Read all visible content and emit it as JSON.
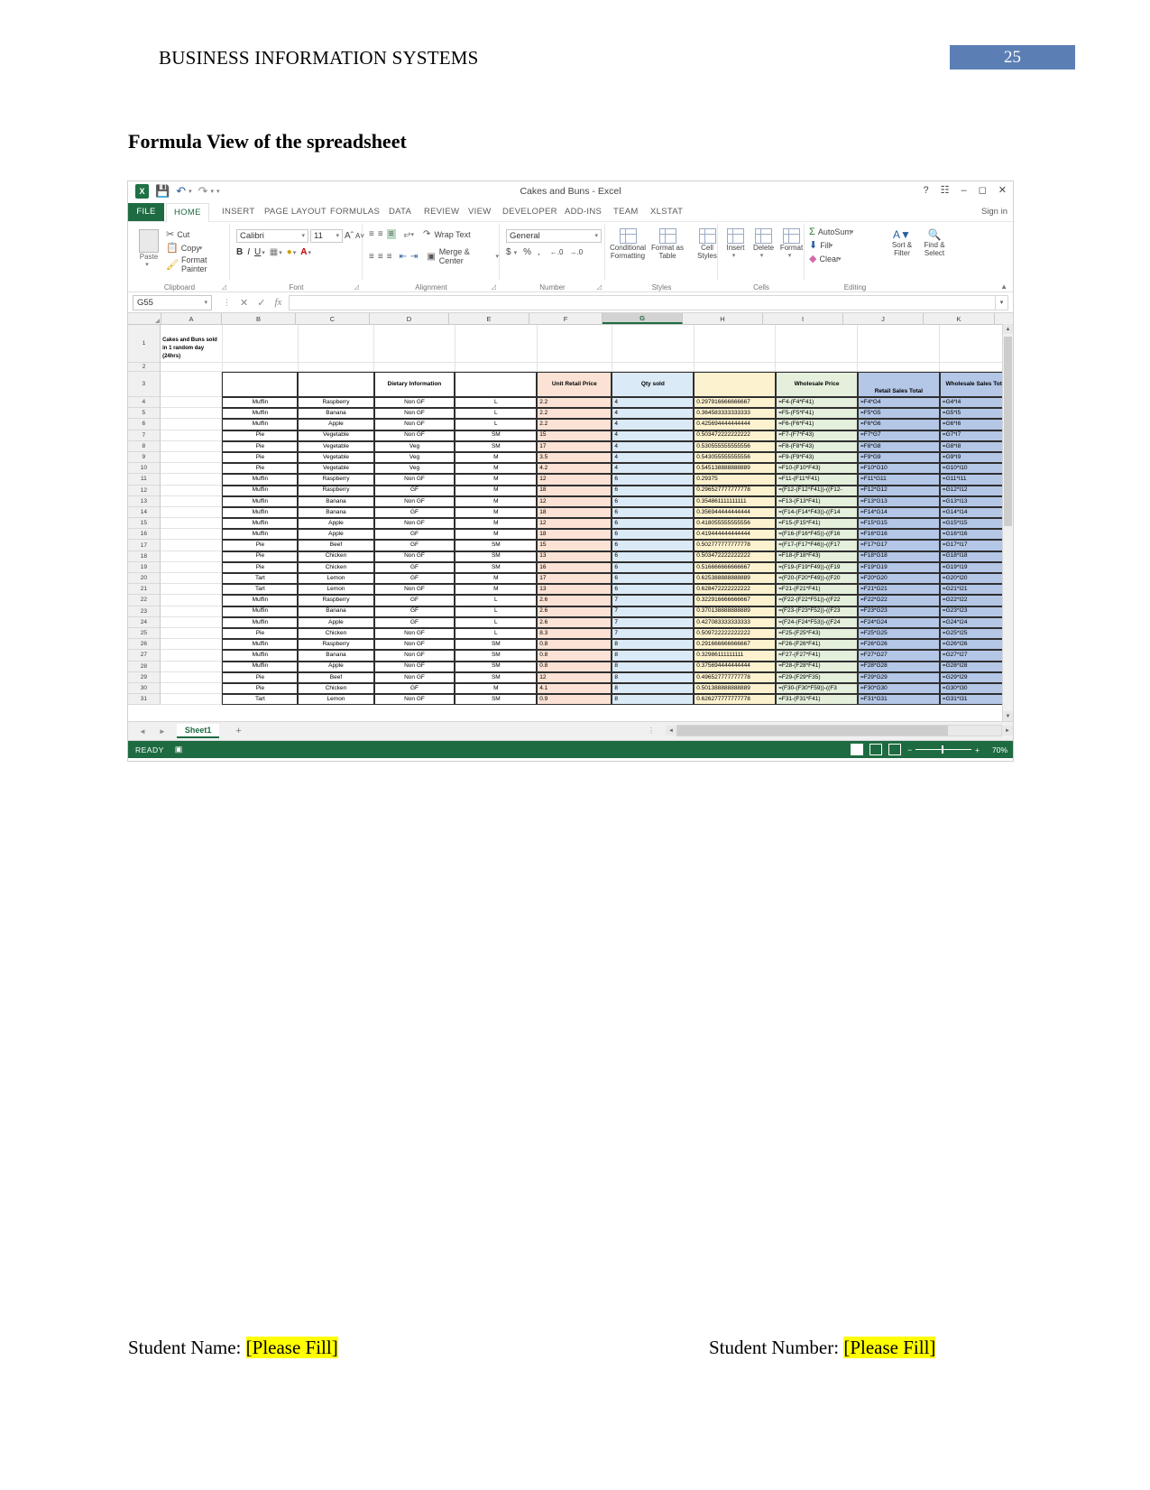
{
  "document": {
    "header_title": "BUSINESS INFORMATION SYSTEMS",
    "page_number": "25",
    "section_title": "Formula View of the spreadsheet",
    "footer": {
      "student_name_label": "Student Name:",
      "student_name_value": "[Please Fill]",
      "student_number_label": "Student Number:",
      "student_number_value": "[Please Fill]"
    },
    "colors": {
      "page_number_bg": "#5b7fb5",
      "highlight": "#ffff00",
      "excel_green": "#1e6b42"
    }
  },
  "excel": {
    "title": "Cakes and Buns - Excel",
    "quick_access": [
      "save-icon",
      "undo-icon",
      "redo-icon",
      "customize-icon"
    ],
    "window_controls": [
      "help-icon",
      "ribbon-display-icon",
      "minimize-icon",
      "restore-icon",
      "close-icon"
    ],
    "sign_in": "Sign in",
    "tabs": [
      "FILE",
      "HOME",
      "INSERT",
      "PAGE LAYOUT",
      "FORMULAS",
      "DATA",
      "REVIEW",
      "VIEW",
      "DEVELOPER",
      "ADD-INS",
      "TEAM",
      "XLSTAT"
    ],
    "active_tab": "HOME",
    "ribbon": {
      "groups": [
        "Clipboard",
        "Font",
        "Alignment",
        "Number",
        "Styles",
        "Cells",
        "Editing"
      ],
      "clipboard": {
        "paste": "Paste",
        "cut": "Cut",
        "copy": "Copy",
        "format_painter": "Format Painter"
      },
      "font": {
        "family": "Calibri",
        "size": "11",
        "bold": "B",
        "italic": "I",
        "underline": "U"
      },
      "alignment": {
        "wrap_text": "Wrap Text",
        "merge_center": "Merge & Center"
      },
      "number": {
        "format": "General",
        "currency": "$",
        "percent": "%",
        "comma": ","
      },
      "styles": {
        "conditional": "Conditional",
        "conditional2": "Formatting",
        "format_table": "Format as",
        "format_table2": "Table",
        "cell_styles": "Cell",
        "cell_styles2": "Styles"
      },
      "cells": {
        "insert": "Insert",
        "delete": "Delete",
        "format": "Format"
      },
      "editing": {
        "autosum": "AutoSum",
        "fill": "Fill",
        "clear": "Clear",
        "sort_filter": "Sort &",
        "sort_filter2": "Filter",
        "find_select": "Find &",
        "find_select2": "Select"
      }
    },
    "formula_bar": {
      "name_box": "G55",
      "value": "",
      "cancel": "cancel-icon",
      "enter": "enter-icon",
      "fx": "fx"
    },
    "sheet": {
      "columns": [
        "A",
        "B",
        "C",
        "D",
        "E",
        "F",
        "G",
        "H",
        "I",
        "J",
        "K"
      ],
      "selected_column": "G",
      "title_cell": "Cakes and Buns sold in 1 random day (24hrs)",
      "headers": {
        "d": "Dietary Information",
        "f": "Unit Retail Price",
        "g": "Qty sold",
        "h": "",
        "i": "Wholesale Price",
        "j": "Retail Sales Total",
        "k": "Wholesale Sales Total"
      },
      "rows": [
        {
          "n": "4",
          "b": "Muffin",
          "c": "Raspberry",
          "d": "Non GF",
          "e": "L",
          "f": "2.2",
          "g": "4",
          "h": "0.297916666666667",
          "i": "=F4-(F4*F41)",
          "j": "=F4*G4",
          "k": "=G4*I4"
        },
        {
          "n": "5",
          "b": "Muffin",
          "c": "Banana",
          "d": "Non GF",
          "e": "L",
          "f": "2.2",
          "g": "4",
          "h": "0.364583333333333",
          "i": "=F5-(F5*F41)",
          "j": "=F5*G5",
          "k": "=G5*I5"
        },
        {
          "n": "6",
          "b": "Muffin",
          "c": "Apple",
          "d": "Non GF",
          "e": "L",
          "f": "2.2",
          "g": "4",
          "h": "0.425694444444444",
          "i": "=F6-(F6*F41)",
          "j": "=F6*G6",
          "k": "=G6*I6"
        },
        {
          "n": "7",
          "b": "Pie",
          "c": "Vegetable",
          "d": "Non GF",
          "e": "SM",
          "f": "15",
          "g": "4",
          "h": "0.503472222222222",
          "i": "=F7-(F7*F43)",
          "j": "=F7*G7",
          "k": "=G7*I7"
        },
        {
          "n": "8",
          "b": "Pie",
          "c": "Vegetable",
          "d": "Veg",
          "e": "SM",
          "f": "17",
          "g": "4",
          "h": "0.530555555555556",
          "i": "=F8-(F8*F43)",
          "j": "=F8*G8",
          "k": "=G8*I8"
        },
        {
          "n": "9",
          "b": "Pie",
          "c": "Vegetable",
          "d": "Veg",
          "e": "M",
          "f": "3.5",
          "g": "4",
          "h": "0.543055555555556",
          "i": "=F9-(F9*F43)",
          "j": "=F9*G9",
          "k": "=G9*I9"
        },
        {
          "n": "10",
          "b": "Pie",
          "c": "Vegetable",
          "d": "Veg",
          "e": "M",
          "f": "4.2",
          "g": "4",
          "h": "0.545138888888889",
          "i": "=F10-(F10*F43)",
          "j": "=F10*G10",
          "k": "=G10*I10"
        },
        {
          "n": "11",
          "b": "Muffin",
          "c": "Raspberry",
          "d": "Non GF",
          "e": "M",
          "f": "12",
          "g": "6",
          "h": "0.29375",
          "i": "=F11-(F11*F41)",
          "j": "=F11*G11",
          "k": "=G11*I11"
        },
        {
          "n": "12",
          "b": "Muffin",
          "c": "Raspberry",
          "d": "GF",
          "e": "M",
          "f": "18",
          "g": "6",
          "h": "0.296527777777778",
          "i": "=(F12-(F12*F41))-((F12-",
          "j": "=F12*G12",
          "k": "=G12*I12"
        },
        {
          "n": "13",
          "b": "Muffin",
          "c": "Banana",
          "d": "Non GF",
          "e": "M",
          "f": "12",
          "g": "6",
          "h": "0.354861111111111",
          "i": "=F13-(F13*F41)",
          "j": "=F13*G13",
          "k": "=G13*I13"
        },
        {
          "n": "14",
          "b": "Muffin",
          "c": "Banana",
          "d": "GF",
          "e": "M",
          "f": "18",
          "g": "6",
          "h": "0.356944444444444",
          "i": "=(F14-(F14*F43))-((F14",
          "j": "=F14*G14",
          "k": "=G14*I14"
        },
        {
          "n": "15",
          "b": "Muffin",
          "c": "Apple",
          "d": "Non GF",
          "e": "M",
          "f": "12",
          "g": "6",
          "h": "0.418055555555556",
          "i": "=F15-(F15*F41)",
          "j": "=F15*G15",
          "k": "=G15*I15"
        },
        {
          "n": "16",
          "b": "Muffin",
          "c": "Apple",
          "d": "GF",
          "e": "M",
          "f": "18",
          "g": "6",
          "h": "0.419444444444444",
          "i": "=(F16-(F16*F45))-((F16",
          "j": "=F16*G16",
          "k": "=G16*I16"
        },
        {
          "n": "17",
          "b": "Pie",
          "c": "Beef",
          "d": "GF",
          "e": "SM",
          "f": "15",
          "g": "6",
          "h": "0.502777777777778",
          "i": "=(F17-(F17*F46))-((F17",
          "j": "=F17*G17",
          "k": "=G17*I17"
        },
        {
          "n": "18",
          "b": "Pie",
          "c": "Chicken",
          "d": "Non GF",
          "e": "SM",
          "f": "13",
          "g": "6",
          "h": "0.503472222222222",
          "i": "=F18-(F18*F43)",
          "j": "=F18*G18",
          "k": "=G18*I18"
        },
        {
          "n": "19",
          "b": "Pie",
          "c": "Chicken",
          "d": "GF",
          "e": "SM",
          "f": "16",
          "g": "6",
          "h": "0.516666666666667",
          "i": "=(F19-(F19*F49))-((F19",
          "j": "=F19*G19",
          "k": "=G19*I19"
        },
        {
          "n": "20",
          "b": "Tart",
          "c": "Lemon",
          "d": "GF",
          "e": "M",
          "f": "17",
          "g": "6",
          "h": "0.625388888888889",
          "i": "=(F20-(F20*F49))-((F20",
          "j": "=F20*G20",
          "k": "=G20*I20"
        },
        {
          "n": "21",
          "b": "Tart",
          "c": "Lemon",
          "d": "Non GF",
          "e": "M",
          "f": "13",
          "g": "6",
          "h": "0.628472222222222",
          "i": "=F21-(F21*F41)",
          "j": "=F21*G21",
          "k": "=G21*I21"
        },
        {
          "n": "22",
          "b": "Muffin",
          "c": "Raspberry",
          "d": "GF",
          "e": "L",
          "f": "2.6",
          "g": "7",
          "h": "0.322916666666667",
          "i": "=(F22-(F22*F51))-((F22",
          "j": "=F22*G22",
          "k": "=G22*I22"
        },
        {
          "n": "23",
          "b": "Muffin",
          "c": "Banana",
          "d": "GF",
          "e": "L",
          "f": "2.6",
          "g": "7",
          "h": "0.370138888888889",
          "i": "=(F23-(F23*F52))-((F23",
          "j": "=F23*G23",
          "k": "=G23*I23"
        },
        {
          "n": "24",
          "b": "Muffin",
          "c": "Apple",
          "d": "GF",
          "e": "L",
          "f": "2.6",
          "g": "7",
          "h": "0.427083333333333",
          "i": "=(F24-(F24*F53))-((F24",
          "j": "=F24*G24",
          "k": "=G24*I24"
        },
        {
          "n": "25",
          "b": "Pie",
          "c": "Chicken",
          "d": "Non GF",
          "e": "L",
          "f": "8.3",
          "g": "7",
          "h": "0.509722222222222",
          "i": "=F25-(F25*F43)",
          "j": "=F25*G25",
          "k": "=G25*I25"
        },
        {
          "n": "26",
          "b": "Muffin",
          "c": "Raspberry",
          "d": "Non GF",
          "e": "SM",
          "f": "0.8",
          "g": "8",
          "h": "0.291666666666667",
          "i": "=F26-(F26*F41)",
          "j": "=F26*G26",
          "k": "=G26*I26"
        },
        {
          "n": "27",
          "b": "Muffin",
          "c": "Banana",
          "d": "Non GF",
          "e": "SM",
          "f": "0.8",
          "g": "8",
          "h": "0.32986111111111",
          "i": "=F27-(F27*F41)",
          "j": "=F27*G27",
          "k": "=G27*I27"
        },
        {
          "n": "28",
          "b": "Muffin",
          "c": "Apple",
          "d": "Non GF",
          "e": "SM",
          "f": "0.8",
          "g": "8",
          "h": "0.375694444444444",
          "i": "=F28-(F28*F41)",
          "j": "=F28*G28",
          "k": "=G28*I28"
        },
        {
          "n": "29",
          "b": "Pie",
          "c": "Beef",
          "d": "Non GF",
          "e": "SM",
          "f": "12",
          "g": "8",
          "h": "0.496527777777778",
          "i": "=F29-(F29*F35)",
          "j": "=F29*G29",
          "k": "=G29*I29"
        },
        {
          "n": "30",
          "b": "Pie",
          "c": "Chicken",
          "d": "GF",
          "e": "M",
          "f": "4.1",
          "g": "8",
          "h": "0.501388888888889",
          "i": "=(F30-(F30*F59))-((F3",
          "j": "=F30*G30",
          "k": "=G30*I30"
        },
        {
          "n": "31",
          "b": "Tart",
          "c": "Lemon",
          "d": "Non GF",
          "e": "SM",
          "f": "0.9",
          "g": "8",
          "h": "0.626277777777778",
          "i": "=F31-(F31*F41)",
          "j": "=F31*G31",
          "k": "=G31*I31"
        }
      ],
      "sheet_tab": "Sheet1",
      "add_sheet": "+"
    },
    "status": {
      "ready": "READY",
      "zoom": "70%"
    }
  }
}
